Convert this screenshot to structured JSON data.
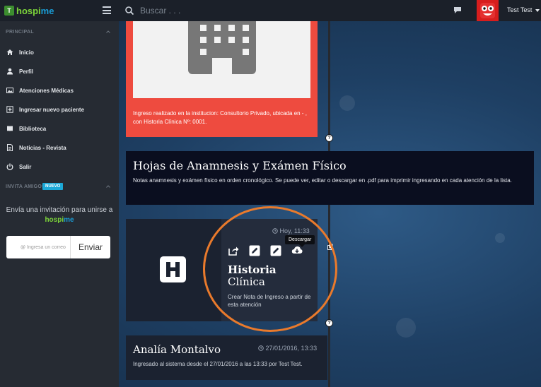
{
  "header": {
    "brand_a": "hospi",
    "brand_b": "me",
    "brand_box": "T",
    "search_placeholder": "Buscar . . .",
    "user_name": "Test Test"
  },
  "sidebar": {
    "section_principal": "PRINCIPAL",
    "items": [
      {
        "label": "Inicio",
        "icon": "home-icon"
      },
      {
        "label": "Perfil",
        "icon": "user-icon"
      },
      {
        "label": "Atenciones Médicas",
        "icon": "image-icon"
      },
      {
        "label": "Ingresar nuevo paciente",
        "icon": "plus-square-icon"
      },
      {
        "label": "Biblioteca",
        "icon": "book-icon"
      },
      {
        "label": "Noticias - Revista",
        "icon": "document-icon"
      },
      {
        "label": "Salir",
        "icon": "power-icon"
      }
    ],
    "section_invite": "INVITA AMIGOS",
    "badge": "NUEVO",
    "invite_text": "Envía una invitación para unirse a",
    "invite_brand_a": "hospi",
    "invite_brand_b": "me",
    "invite_placeholder": "@ Ingresa un correo",
    "send_label": "Enviar"
  },
  "timeline": {
    "red_card_text": "Ingreso realizado en la institucion: Consultorio Privado, ubicada en - , con Historia Clínica Nº: 0001.",
    "node_marker": "?",
    "anamnesis_title": "Hojas de Anamnesis y Exámen Físico",
    "anamnesis_desc": "Notas anamnesis y exámen físico en orden cronológico. Se puede ver, editar o descargar en .pdf para imprimir ingresando en cada atención de la lista.",
    "hc_time": "Hoy, 11:33",
    "hc_tooltip": "Descargar",
    "hc_title_1": "Historia",
    "hc_title_2": "Clínica",
    "hc_desc": "Crear Nota de Ingreso a partir de esta atención",
    "user_name": "Analía Montalvo",
    "user_date": "27/01/2016, 13:33",
    "user_desc": "Ingresado al sistema desde el 27/01/2016 a las 13:33 por Test Test."
  },
  "colors": {
    "topbar": "#1b2029",
    "sidebar": "#262b33",
    "red_card": "#ee4b3f",
    "dark_card": "#0a0e1f",
    "highlight": "#e97a2c",
    "brand_green": "#7cd43a",
    "brand_blue": "#1a9bd4"
  }
}
